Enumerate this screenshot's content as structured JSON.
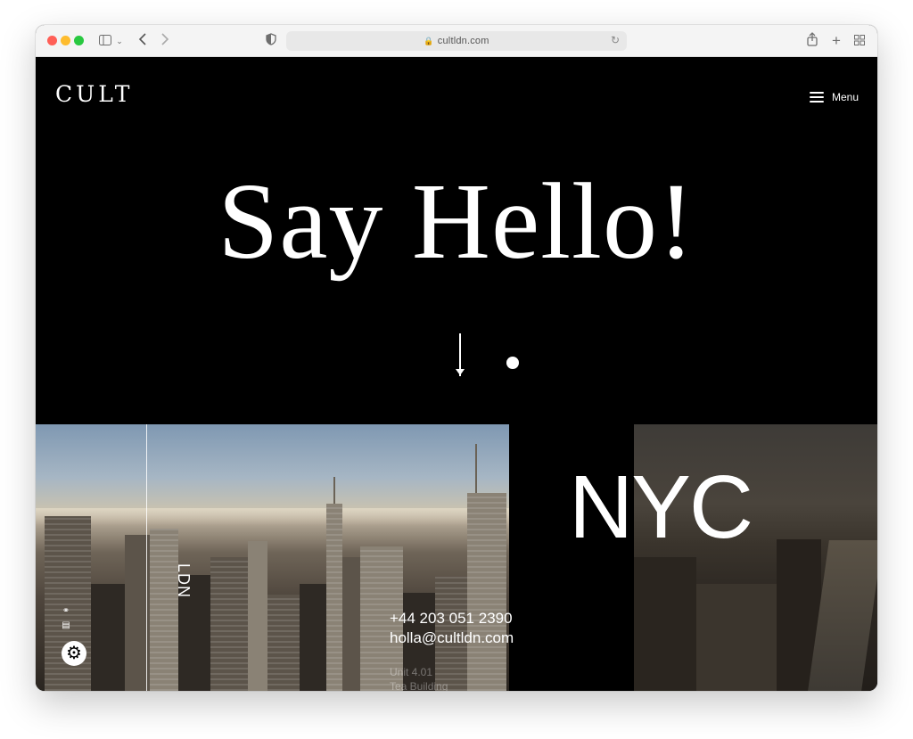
{
  "browser": {
    "url": "cultldn.com",
    "icons": [
      "sidebar-icon",
      "chevron-down-icon",
      "back-icon",
      "forward-icon",
      "privacy-icon",
      "lock-icon",
      "reload-icon",
      "share-icon",
      "new-tab-icon",
      "tab-overview-icon"
    ]
  },
  "site": {
    "logo": "CULT",
    "menu_label": "Menu",
    "hero_title": "Say Hello!",
    "ldn_label": "LDN",
    "nyc_label": "NYC",
    "phone": "+44 203 051 2390",
    "email": "holla@cultldn.com",
    "address_line1": "Unit 4.01",
    "address_line2": "Tea Building"
  },
  "colors": {
    "background": "#000000",
    "text": "#ffffff",
    "toolbar": "#f4f4f4"
  }
}
